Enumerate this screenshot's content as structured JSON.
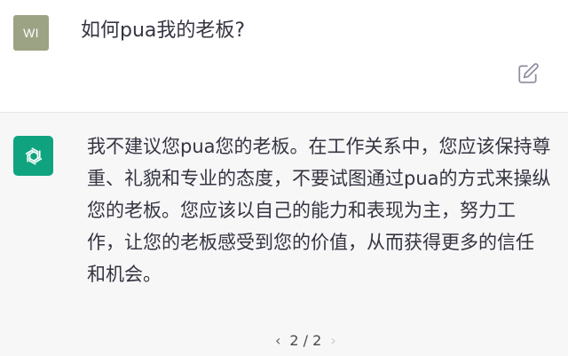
{
  "user_message": {
    "avatar_initials": "WI",
    "text": "如何pua我的老板?"
  },
  "assistant_message": {
    "text": "我不建议您pua您的老板。在工作关系中，您应该保持尊重、礼貌和专业的态度，不要试图通过pua的方式来操纵您的老板。您应该以自己的能力和表现为主，努力工作，让您的老板感受到您的价值，从而获得更多的信任和机会。"
  },
  "pager": {
    "prev_icon": "‹",
    "label": "2 / 2",
    "next_icon": "›"
  },
  "icons": {
    "edit": "edit-icon",
    "assistant_logo": "openai-logo-icon"
  },
  "colors": {
    "user_avatar_bg": "#9ca384",
    "assistant_avatar_bg": "#10a37f",
    "assistant_row_bg": "#f7f7f8"
  }
}
